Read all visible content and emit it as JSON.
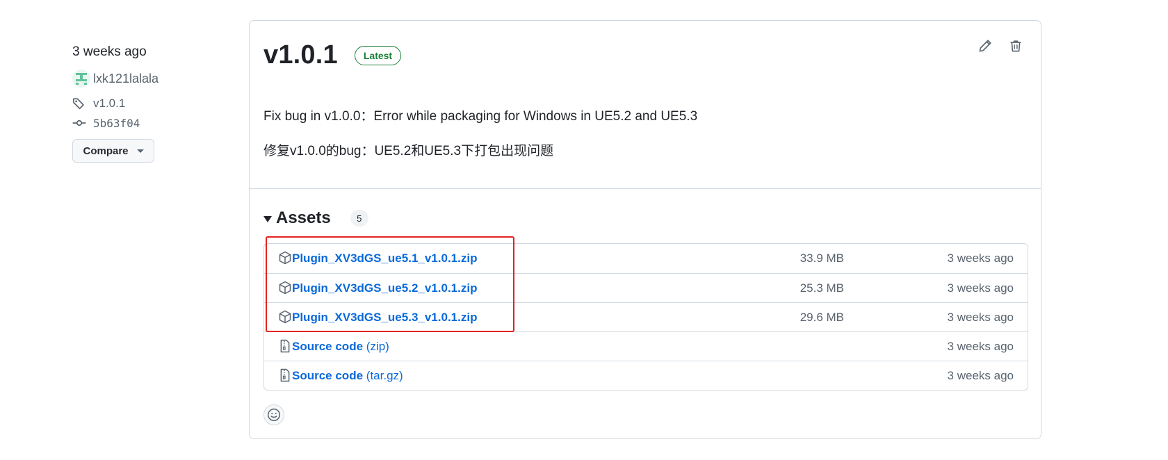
{
  "meta": {
    "time": "3 weeks ago",
    "author": "lxk121lalala",
    "tag": "v1.0.1",
    "commit": "5b63f04",
    "compare_label": "Compare"
  },
  "release": {
    "title": "v1.0.1",
    "badge": "Latest",
    "notes": [
      "Fix bug in v1.0.0：Error while packaging for Windows in UE5.2 and UE5.3",
      "修复v1.0.0的bug：UE5.2和UE5.3下打包出现问题"
    ]
  },
  "assets": {
    "title": "Assets",
    "count": "5",
    "items": [
      {
        "icon": "package-icon",
        "name": "Plugin_XV3dGS_ue5.1_v1.0.1.zip",
        "suffix": "",
        "size": "33.9 MB",
        "date": "3 weeks ago"
      },
      {
        "icon": "package-icon",
        "name": "Plugin_XV3dGS_ue5.2_v1.0.1.zip",
        "suffix": "",
        "size": "25.3 MB",
        "date": "3 weeks ago"
      },
      {
        "icon": "package-icon",
        "name": "Plugin_XV3dGS_ue5.3_v1.0.1.zip",
        "suffix": "",
        "size": "29.6 MB",
        "date": "3 weeks ago"
      },
      {
        "icon": "file-zip-icon",
        "name": "Source code",
        "suffix": "(zip)",
        "size": "",
        "date": "3 weeks ago"
      },
      {
        "icon": "file-zip-icon",
        "name": "Source code",
        "suffix": "(tar.gz)",
        "size": "",
        "date": "3 weeks ago"
      }
    ]
  },
  "colors": {
    "link": "#0969da",
    "latest_badge": "#1a7f37",
    "highlight_box": "#e3231f"
  }
}
